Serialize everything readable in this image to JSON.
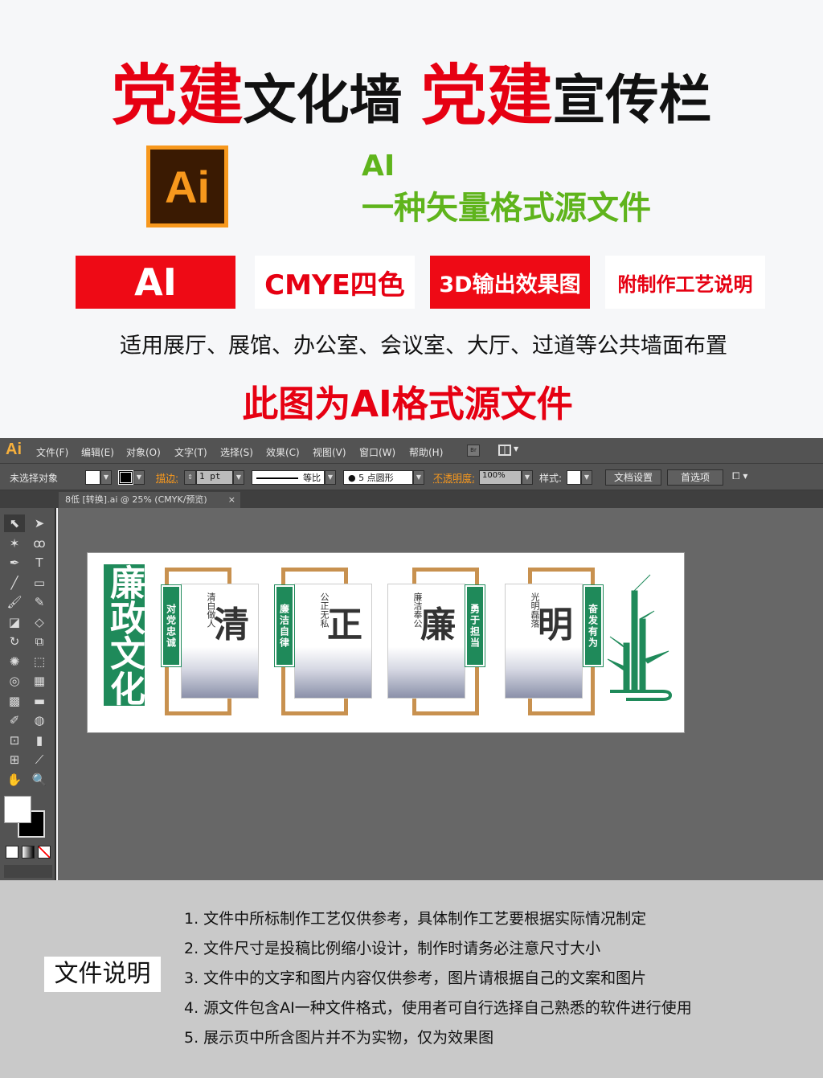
{
  "header": {
    "title": [
      {
        "text": "党建",
        "style": "red"
      },
      {
        "text": "文化墙 ",
        "style": "black"
      },
      {
        "text": "党建",
        "style": "red"
      },
      {
        "text": "宣传栏",
        "style": "black"
      }
    ],
    "logo_text": "Ai",
    "format_line1": "AI",
    "format_line2": "一种矢量格式源文件",
    "badges": [
      "AI",
      "CMYE四色",
      "3D输出效果图",
      "附制作工艺说明"
    ],
    "usage": "适用展厅、展馆、办公室、会议室、大厅、过道等公共墙面布置",
    "note": "此图为AI格式源文件"
  },
  "app": {
    "logo": "Ai",
    "menu": [
      "文件(F)",
      "编辑(E)",
      "对象(O)",
      "文字(T)",
      "选择(S)",
      "效果(C)",
      "视图(V)",
      "窗口(W)",
      "帮助(H)"
    ],
    "bridge_label": "Br",
    "control": {
      "selection": "未选择对象",
      "stroke_label": "描边:",
      "stroke_value": "1 pt",
      "profile": "等比",
      "brush": "5 点圆形",
      "opacity_label": "不透明度:",
      "opacity_value": "100%",
      "style_label": "样式:",
      "doc_setup": "文档设置",
      "prefs": "首选项"
    },
    "document_tab": "8低 [转换].ai @ 25% (CMYK/预览)",
    "close": "×",
    "tools": [
      [
        "selection-tool",
        "⬉"
      ],
      [
        "direct-selection-tool",
        "➤"
      ],
      [
        "magic-wand-tool",
        "✶"
      ],
      [
        "lasso-tool",
        "ꝏ"
      ],
      [
        "pen-tool",
        "✒"
      ],
      [
        "type-tool",
        "T"
      ],
      [
        "line-tool",
        "╱"
      ],
      [
        "rectangle-tool",
        "▭"
      ],
      [
        "paintbrush-tool",
        "🖌"
      ],
      [
        "pencil-tool",
        "✎"
      ],
      [
        "blob-brush-tool",
        "◪"
      ],
      [
        "eraser-tool",
        "◇"
      ],
      [
        "rotate-tool",
        "↻"
      ],
      [
        "scale-tool",
        "⧉"
      ],
      [
        "warp-tool",
        "✺"
      ],
      [
        "free-transform-tool",
        "⬚"
      ],
      [
        "shape-builder-tool",
        "◎"
      ],
      [
        "perspective-grid-tool",
        "▦"
      ],
      [
        "mesh-tool",
        "▩"
      ],
      [
        "gradient-tool",
        "▬"
      ],
      [
        "eyedropper-tool",
        "✐"
      ],
      [
        "blend-tool",
        "◍"
      ],
      [
        "symbol-sprayer-tool",
        "⊡"
      ],
      [
        "column-graph-tool",
        "▮"
      ],
      [
        "artboard-tool",
        "⊞"
      ],
      [
        "slice-tool",
        "⟋"
      ],
      [
        "hand-tool",
        "✋"
      ],
      [
        "zoom-tool",
        "🔍"
      ]
    ]
  },
  "artwork": {
    "side_title": "廉政文化",
    "panels": [
      {
        "big": "清",
        "poem": "清白做人",
        "strip": "对党忠诚"
      },
      {
        "big": "正",
        "poem": "公正无私",
        "strip": "廉洁自律"
      },
      {
        "big": "廉",
        "poem": "廉洁奉公",
        "strip": "勇于担当"
      },
      {
        "big": "明",
        "poem": "光明磊落",
        "strip": "奋发有为"
      }
    ],
    "colors": {
      "green": "#1f8a5a",
      "gold": "#c8914f"
    }
  },
  "footer": {
    "label": "文件说明",
    "items": [
      "1. 文件中所标制作工艺仅供参考，具体制作工艺要根据实际情况制定",
      "2. 文件尺寸是投稿比例缩小设计，制作时请务必注意尺寸大小",
      "3. 文件中的文字和图片内容仅供参考，图片请根据自己的文案和图片",
      "4. 源文件包含AI一种文件格式，使用者可自行选择自己熟悉的软件进行使用",
      "5. 展示页中所含图片并不为实物，仅为效果图"
    ]
  }
}
